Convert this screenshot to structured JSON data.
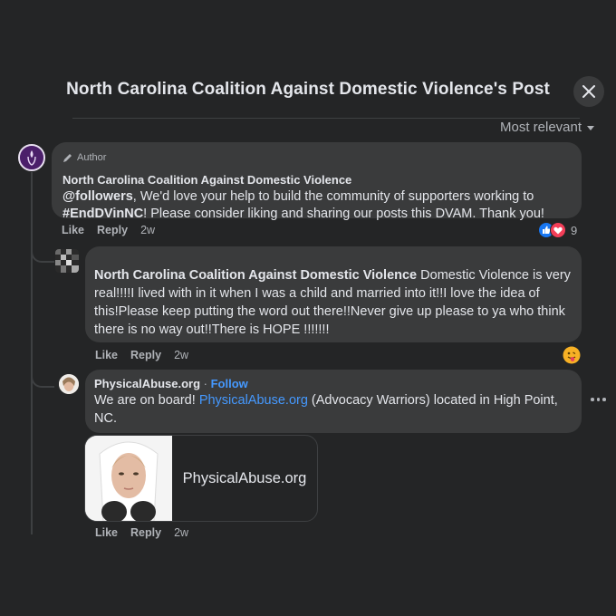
{
  "post": {
    "title": "North Carolina Coalition Against Domestic Violence's Post"
  },
  "sort": {
    "label": "Most relevant"
  },
  "comments": [
    {
      "author_tag": "Author",
      "author": "North Carolina Coalition Against Domestic Violence",
      "mention": "@followers",
      "text_a": ", We'd love your help to build the community of supporters working to ",
      "hashtag": "#EndDVinNC",
      "text_b": "! Please consider liking and sharing our posts this DVAM. Thank you!",
      "like": "Like",
      "reply": "Reply",
      "time": "2w",
      "reaction_count": "9"
    },
    {
      "mention": "North Carolina Coalition Against Domestic Violence",
      "text": " Domestic Violence is very real!!!!I lived with in it when I was a child and married into it!!I love the idea of this!Please keep putting the word out there!!Never give up please to ya who think there is no way out!!There is HOPE !!!!!!!",
      "like": "Like",
      "reply": "Reply",
      "time": "2w"
    },
    {
      "author": "PhysicalAbuse.org",
      "separator": " · ",
      "follow": "Follow",
      "text_a": "We are on board! ",
      "link": "PhysicalAbuse.org",
      "text_b": " (Advocacy Warriors) located in High Point, NC.",
      "card_title": "PhysicalAbuse.org",
      "like": "Like",
      "reply": "Reply",
      "time": "2w"
    }
  ],
  "colors": {
    "background": "#242526",
    "bubble": "#3a3b3c",
    "link": "#4599ff",
    "secondary_text": "#b0b3b8"
  }
}
